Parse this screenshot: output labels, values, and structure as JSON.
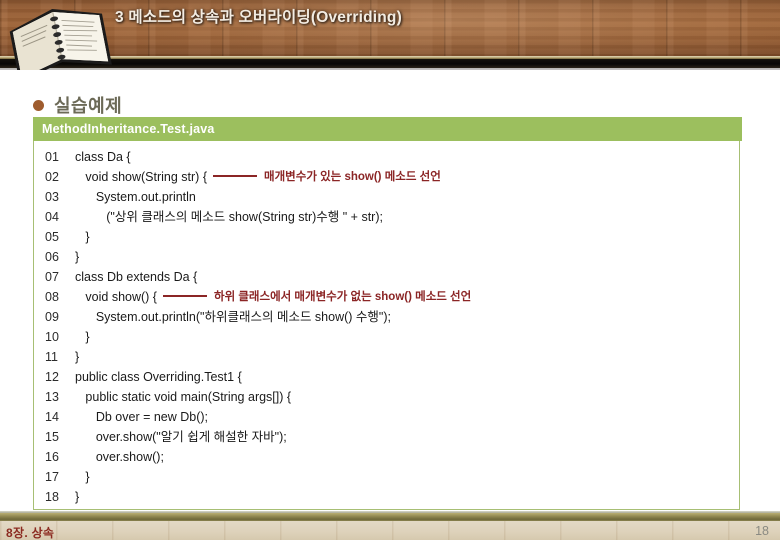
{
  "header": {
    "title": "3 메소드의 상속과 오버라이딩(Overriding)",
    "book_icon": "open-book-icon"
  },
  "section": {
    "bullet_icon": "bullet-dot-icon",
    "label": "실습예제"
  },
  "file_bar": {
    "filename": "MethodInheritance.Test.java"
  },
  "code": {
    "lines": [
      {
        "num": "01",
        "text": "class Da {",
        "note": ""
      },
      {
        "num": "02",
        "text": "   void show(String str) {",
        "note": "매개변수가 있는 show() 메소드 선언"
      },
      {
        "num": "03",
        "text": "      System.out.println",
        "note": ""
      },
      {
        "num": "04",
        "text": "         (\"상위 클래스의 메소드 show(String str)수행 \" + str);",
        "note": ""
      },
      {
        "num": "05",
        "text": "   }",
        "note": ""
      },
      {
        "num": "06",
        "text": "}",
        "note": ""
      },
      {
        "num": "07",
        "text": "class Db extends Da {",
        "note": ""
      },
      {
        "num": "08",
        "text": "   void show() {",
        "note": "하위 클래스에서 매개변수가 없는 show() 메소드 선언"
      },
      {
        "num": "09",
        "text": "      System.out.println(\"하위클래스의 메소드 show() 수행\");",
        "note": ""
      },
      {
        "num": "10",
        "text": "   }",
        "note": ""
      },
      {
        "num": "11",
        "text": "}",
        "note": ""
      },
      {
        "num": "12",
        "text": "public class Overriding.Test1 {",
        "note": ""
      },
      {
        "num": "13",
        "text": "   public static void main(String args[]) {",
        "note": ""
      },
      {
        "num": "14",
        "text": "      Db over = new Db();",
        "note": ""
      },
      {
        "num": "15",
        "text": "      over.show(\"알기 쉽게 해설한 자바\");",
        "note": ""
      },
      {
        "num": "16",
        "text": "      over.show();",
        "note": ""
      },
      {
        "num": "17",
        "text": "   }",
        "note": ""
      },
      {
        "num": "18",
        "text": "}",
        "note": ""
      }
    ]
  },
  "footer": {
    "chapter": "8장. 상속",
    "page_number": "18"
  },
  "colors": {
    "wood_brown": "#a3673a",
    "accent_green": "#9cbf5e",
    "note_red": "#8b2525",
    "section_gray": "#6c6a57",
    "footer_red": "#8b2a20"
  }
}
